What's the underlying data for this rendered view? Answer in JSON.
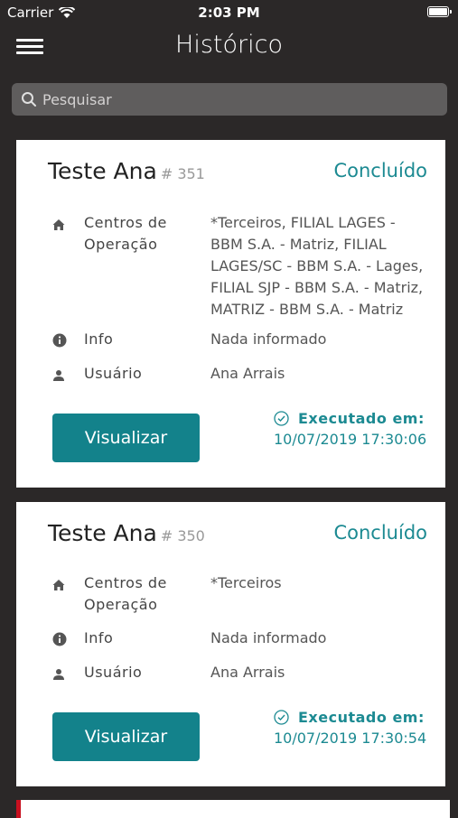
{
  "status_bar": {
    "carrier": "Carrier",
    "time": "2:03 PM"
  },
  "header": {
    "title": "Histórico"
  },
  "search": {
    "placeholder": "Pesquisar"
  },
  "cards": [
    {
      "title": "Teste Ana",
      "number": "# 351",
      "status": "Concluído",
      "rows": [
        {
          "label": "Centros de Operação",
          "value": "*Terceiros, FILIAL LAGES - BBM S.A. - Matriz, FILIAL LAGES/SC - BBM S.A. - Lages, FILIAL SJP - BBM S.A. - Matriz, MATRIZ - BBM S.A. - Matriz"
        },
        {
          "label": "Info",
          "value": "Nada informado"
        },
        {
          "label": "Usuário",
          "value": "Ana Arrais"
        }
      ],
      "button_label": "Visualizar",
      "executed_label": "Executado em:",
      "executed_at": "10/07/2019 17:30:06"
    },
    {
      "title": "Teste Ana",
      "number": "# 350",
      "status": "Concluído",
      "rows": [
        {
          "label": "Centros de Operação",
          "value": "*Terceiros"
        },
        {
          "label": "Info",
          "value": "Nada informado"
        },
        {
          "label": "Usuário",
          "value": "Ana Arrais"
        }
      ],
      "button_label": "Visualizar",
      "executed_label": "Executado em:",
      "executed_at": "10/07/2019 17:30:54"
    }
  ],
  "colors": {
    "background": "#2b2828",
    "accent": "#13828b",
    "status": "#1c8a92",
    "partial_card_border": "#c8101f"
  },
  "icons": {
    "menu": "hamburger-menu-icon",
    "search": "search-icon",
    "operation_center": "home-icon",
    "info": "info-icon",
    "user": "user-icon",
    "executed": "check-circle-icon"
  }
}
